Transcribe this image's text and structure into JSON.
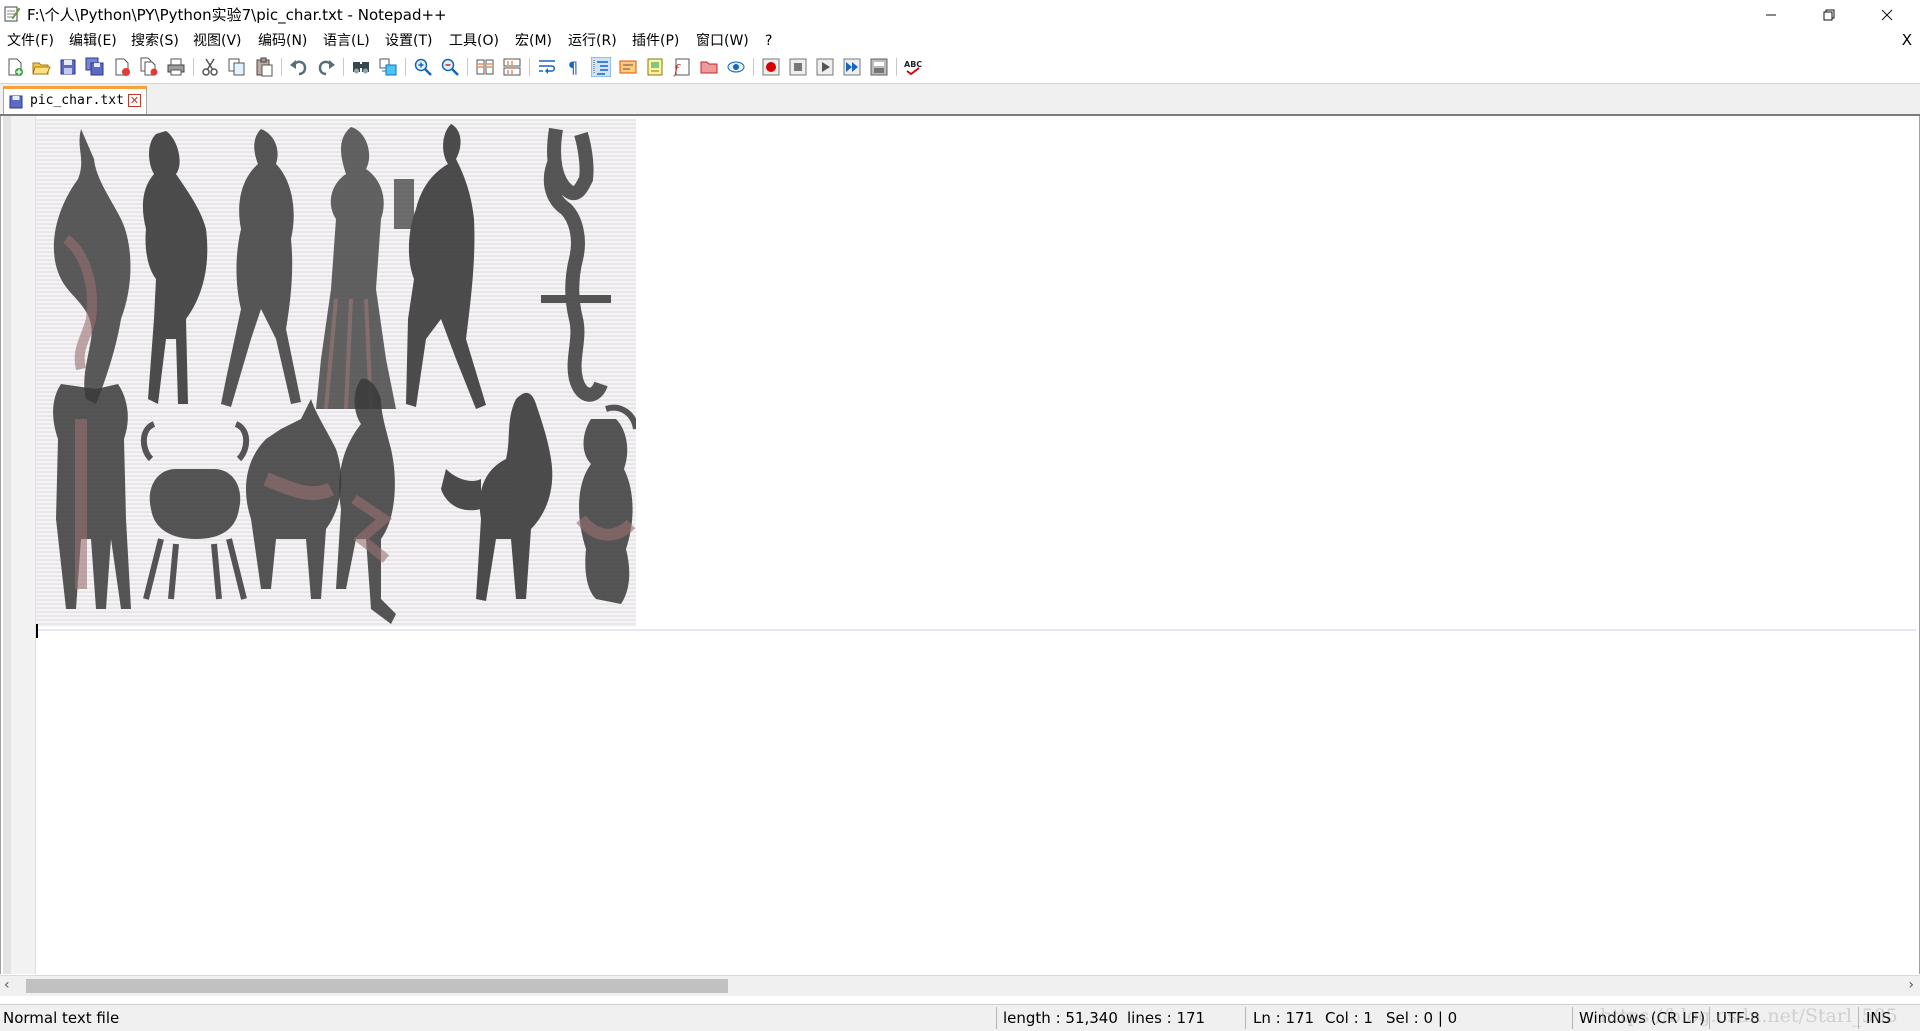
{
  "window": {
    "title": "F:\\个人\\Python\\PY\\Python实验7\\pic_char.txt - Notepad++",
    "minimize_icon": "minimize-icon",
    "maximize_icon": "restore-icon",
    "close_icon": "close-icon"
  },
  "menu": {
    "items": [
      "文件(F)",
      "编辑(E)",
      "搜索(S)",
      "视图(V)",
      "编码(N)",
      "语言(L)",
      "设置(T)",
      "工具(O)",
      "宏(M)",
      "运行(R)",
      "插件(P)",
      "窗口(W)",
      "?"
    ],
    "close_doc": "X"
  },
  "toolbar": {
    "icons": [
      "new-file-icon",
      "open-file-icon",
      "save-icon",
      "save-all-icon",
      "close-icon",
      "close-all-icon",
      "print-icon",
      "cut-icon",
      "copy-icon",
      "paste-icon",
      "undo-icon",
      "redo-icon",
      "find-icon",
      "replace-icon",
      "zoom-in-icon",
      "zoom-out-icon",
      "sync-vertical-icon",
      "sync-horizontal-icon",
      "word-wrap-icon",
      "show-all-chars-icon",
      "indent-guide-icon",
      "user-language-icon",
      "document-map-icon",
      "function-list-icon",
      "folder-workspace-icon",
      "monitoring-icon",
      "macro-record-icon",
      "macro-stop-icon",
      "macro-play-icon",
      "macro-run-multiple-icon",
      "macro-save-icon",
      "spell-check-icon"
    ]
  },
  "tabs": [
    {
      "label": "pic_char.txt",
      "icon": "saved-file-icon",
      "close_icon": "tab-close-icon"
    }
  ],
  "editor": {
    "content_description_icon": "ascii-art-zodiac-figures"
  },
  "status": {
    "file_type": "Normal text file",
    "length": "length : 51,340",
    "lines": "lines : 171",
    "ln": "Ln : 171",
    "col": "Col : 1",
    "sel": "Sel : 0 | 0",
    "eol": "Windows (CR LF)",
    "encoding": "UTF-8",
    "mode": "INS"
  },
  "watermark": "https://blog.csdn.net/Starl_505",
  "colors": {
    "tab_accent": "#f9a03a",
    "art_dark": "#3a3a3a",
    "art_red": "#8a5a5a",
    "line_bg": "#e6e6fa"
  }
}
